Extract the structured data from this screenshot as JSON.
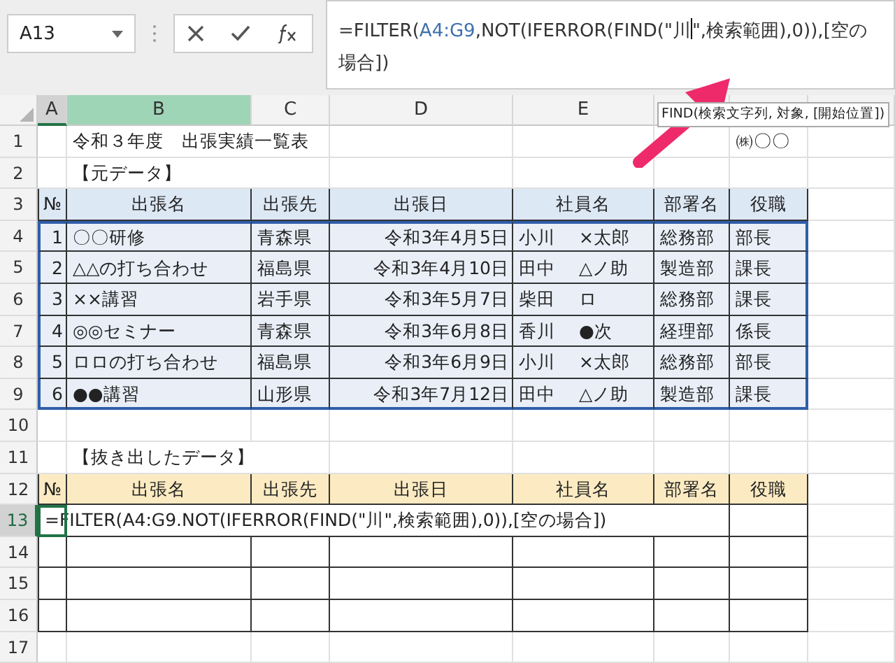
{
  "name_box": {
    "value": "A13"
  },
  "formula_bar": {
    "segments": [
      {
        "kind": "text",
        "text": "=FILTER(",
        "color": "#333333"
      },
      {
        "kind": "text",
        "text": "A4:G9",
        "color": "#3f6fb0"
      },
      {
        "kind": "text",
        "text": ",NOT(IFERROR(FIND(\"川",
        "color": "#333333"
      },
      {
        "kind": "cursor"
      },
      {
        "kind": "text",
        "text": "\",検索範囲),0)),[空の場合])",
        "color": "#333333"
      }
    ]
  },
  "tooltip": {
    "text": "FIND(検索文字列, 対象, [開始位置])"
  },
  "columns": [
    {
      "label": "A",
      "active": true,
      "selected": false
    },
    {
      "label": "B",
      "active": false,
      "selected": true
    },
    {
      "label": "C",
      "active": false,
      "selected": false
    },
    {
      "label": "D",
      "active": false,
      "selected": false
    },
    {
      "label": "E",
      "active": false,
      "selected": false
    },
    {
      "active": false,
      "selected": false
    },
    {
      "active": false,
      "selected": false
    }
  ],
  "rows": [
    {
      "number": "1",
      "active": false,
      "kind": "plain",
      "cells": {
        "B": "令和３年度　出張実績一覧表",
        "G": "㈱〇〇"
      }
    },
    {
      "number": "2",
      "active": false,
      "kind": "plain",
      "cells": {
        "B": "【元データ】"
      }
    },
    {
      "number": "3",
      "active": false,
      "kind": "header-blue",
      "cells": {
        "A": "№",
        "B": "出張名",
        "C": "出張先",
        "D": "出張日",
        "E": "社員名",
        "F": "部署名",
        "G": "役職"
      }
    },
    {
      "number": "4",
      "active": false,
      "kind": "data",
      "cells": {
        "A": "1",
        "B": "〇〇研修",
        "C": "青森県",
        "D": "令和3年4月5日",
        "E": "小川　 ×太郎",
        "F": "総務部",
        "G": "部長"
      }
    },
    {
      "number": "5",
      "active": false,
      "kind": "data",
      "cells": {
        "A": "2",
        "B": "△△の打ち合わせ",
        "C": "福島県",
        "D": "令和3年4月10日",
        "E": "田中　 △ノ助",
        "F": "製造部",
        "G": "課長"
      }
    },
    {
      "number": "6",
      "active": false,
      "kind": "data",
      "cells": {
        "A": "3",
        "B": "××講習",
        "C": "岩手県",
        "D": "令和3年5月7日",
        "E": "柴田　 ロ",
        "F": "総務部",
        "G": "課長"
      }
    },
    {
      "number": "7",
      "active": false,
      "kind": "data",
      "cells": {
        "A": "4",
        "B": "◎◎セミナー",
        "C": "青森県",
        "D": "令和3年6月8日",
        "E": "香川　 ●次",
        "F": "経理部",
        "G": "係長"
      }
    },
    {
      "number": "8",
      "active": false,
      "kind": "data",
      "cells": {
        "A": "5",
        "B": "ロロの打ち合わせ",
        "C": "福島県",
        "D": "令和3年6月9日",
        "E": "小川　 ×太郎",
        "F": "総務部",
        "G": "部長"
      }
    },
    {
      "number": "9",
      "active": false,
      "kind": "data",
      "cells": {
        "A": "6",
        "B": "●●講習",
        "C": "山形県",
        "D": "令和3年7月12日",
        "E": "田中　 △ノ助",
        "F": "製造部",
        "G": "課長"
      }
    },
    {
      "number": "10",
      "active": false,
      "kind": "plain",
      "cells": {}
    },
    {
      "number": "11",
      "active": false,
      "kind": "plain",
      "cells": {
        "B": "【抜き出したデータ】"
      }
    },
    {
      "number": "12",
      "active": false,
      "kind": "header-yellow",
      "cells": {
        "A": "№",
        "B": "出張名",
        "C": "出張先",
        "D": "出張日",
        "E": "社員名",
        "F": "部署名",
        "G": "役職"
      }
    },
    {
      "number": "13",
      "active": true,
      "kind": "formula",
      "cells": {
        "A": "=FILTER(A4:G9.NOT(IFERROR(FIND(\"川\",検索範囲),0)),[空の場合])"
      }
    },
    {
      "number": "14",
      "active": false,
      "kind": "empty-table",
      "cells": {}
    },
    {
      "number": "15",
      "active": false,
      "kind": "empty-table",
      "cells": {}
    },
    {
      "number": "16",
      "active": false,
      "kind": "empty-table",
      "cells": {}
    },
    {
      "number": "17",
      "active": false,
      "kind": "plain",
      "cells": {}
    }
  ]
}
